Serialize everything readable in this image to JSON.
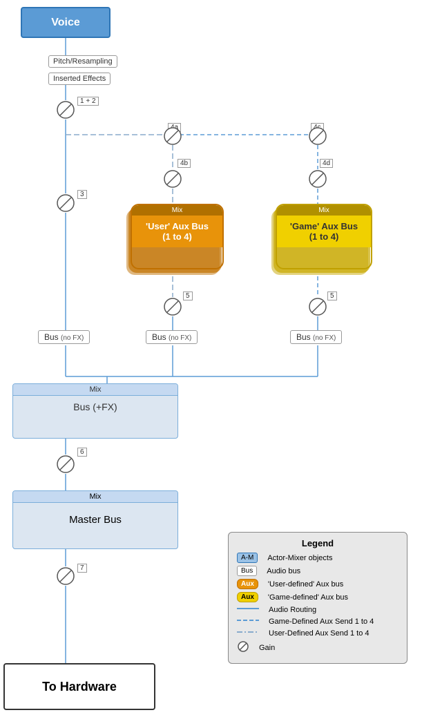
{
  "voice": {
    "label": "Voice"
  },
  "pitch_box": {
    "label": "Pitch/Resampling"
  },
  "inserted_effects_box": {
    "label": "Inserted Effects"
  },
  "num_labels": {
    "n1_2": "1 + 2",
    "n3": "3",
    "n4a": "4a",
    "n4b": "4b",
    "n4c": "4c",
    "n4d": "4d",
    "n5a": "5",
    "n5b": "5",
    "n6": "6",
    "n7": "7"
  },
  "bus_labels": {
    "bus1": "Bus",
    "bus1_sub": "(no FX)",
    "bus2": "Bus",
    "bus2_sub": "(no FX)",
    "bus3": "Bus",
    "bus3_sub": "(no FX)"
  },
  "mix_bus_plus_fx": {
    "mix_label": "Mix",
    "content": "Bus (+FX)"
  },
  "master_bus": {
    "mix_label": "Mix",
    "content": "Master Bus"
  },
  "to_hardware": {
    "label": "To Hardware"
  },
  "user_aux": {
    "mix_label": "Mix",
    "name": "'User' Aux Bus",
    "range": "(1 to 4)"
  },
  "game_aux": {
    "mix_label": "Mix",
    "name": "'Game' Aux Bus",
    "range": "(1 to 4)"
  },
  "legend": {
    "title": "Legend",
    "rows": [
      {
        "swatch": "am",
        "label": "Actor-Mixer objects"
      },
      {
        "swatch": "bus",
        "label": "Audio bus"
      },
      {
        "swatch": "aux-orange",
        "label": "'User-defined' Aux bus"
      },
      {
        "swatch": "aux-yellow",
        "label": "'Game-defined' Aux bus"
      },
      {
        "swatch": "line-solid",
        "label": "Audio Routing"
      },
      {
        "swatch": "line-dashed",
        "label": "Game-Defined Aux Send 1 to 4"
      },
      {
        "swatch": "line-dashdot",
        "label": "User-Defined Aux Send 1 to 4"
      },
      {
        "swatch": "gain",
        "label": "Gain"
      }
    ]
  }
}
